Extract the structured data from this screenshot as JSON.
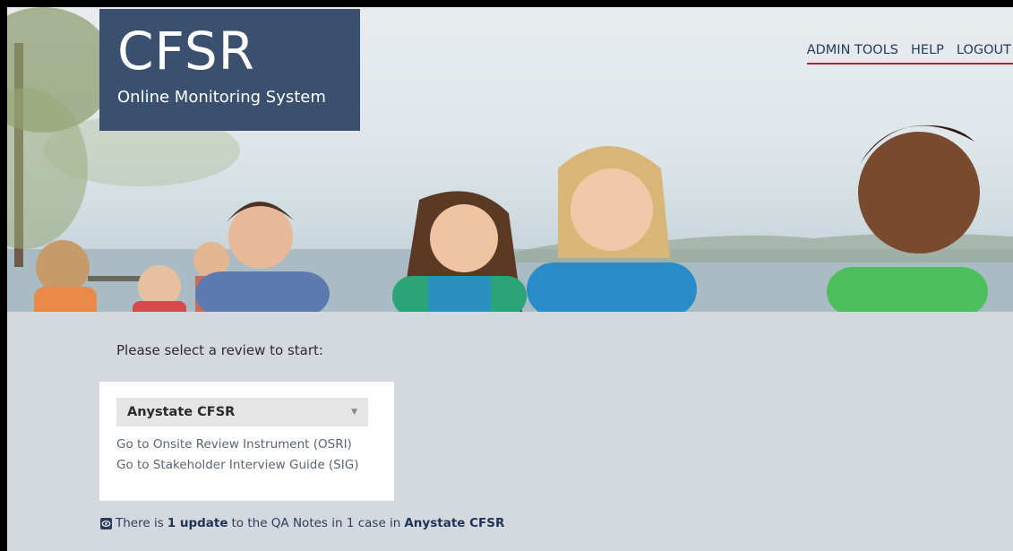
{
  "brand": {
    "title": "CFSR",
    "subtitle": "Online Monitoring System"
  },
  "nav": {
    "admin_tools": "ADMIN TOOLS",
    "help": "HELP",
    "logout": "LOGOUT"
  },
  "main": {
    "prompt": "Please select a review to start:",
    "review_select": {
      "selected": "Anystate CFSR"
    },
    "links": {
      "osri": "Go to Onsite Review Instrument (OSRI)",
      "sig": "Go to Stakeholder Interview Guide (SIG)"
    },
    "notice": {
      "text_prefix": "There is",
      "count": "1 update",
      "text_middle": "to the QA Notes in 1 case in",
      "review": "Anystate CFSR"
    }
  },
  "colors": {
    "brand_bg": "#3b4f6e",
    "nav_text": "#223a5e",
    "nav_underline": "#b22234",
    "page_bg": "#d3d9df"
  },
  "icons": {
    "notice": "eye-icon",
    "select": "chevron-down-icon"
  }
}
